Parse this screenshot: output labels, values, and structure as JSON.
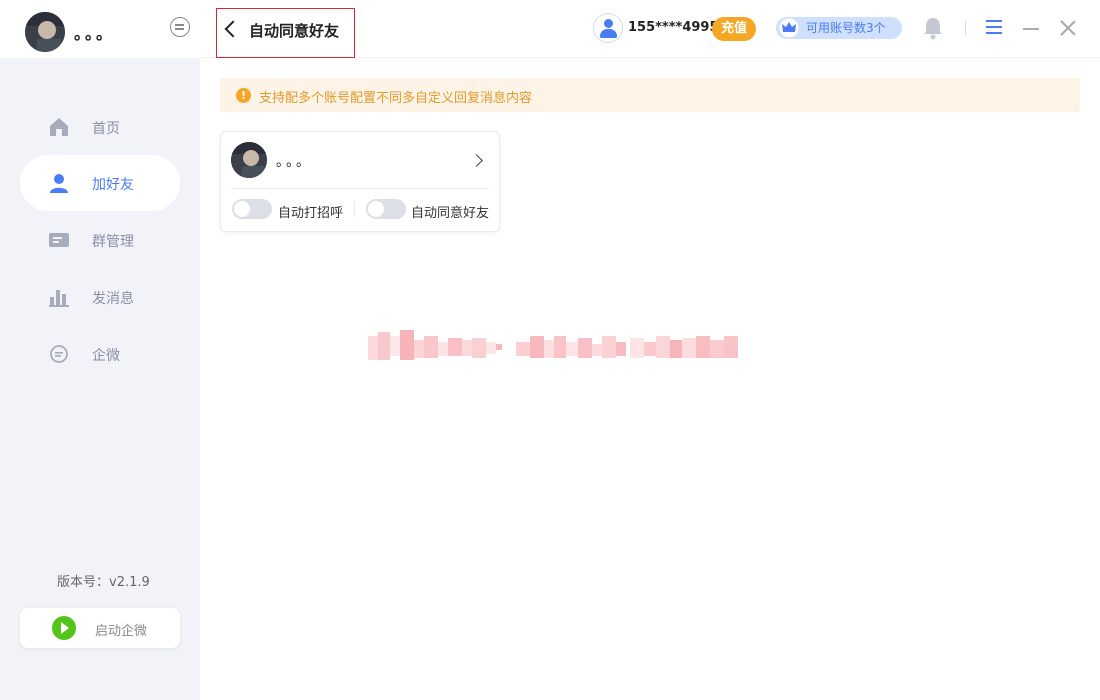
{
  "profile": {
    "name": "。。。"
  },
  "sidebar": {
    "items": [
      {
        "label": "首页",
        "icon": "home-icon",
        "active": false
      },
      {
        "label": "加好友",
        "icon": "user-icon",
        "active": true
      },
      {
        "label": "群管理",
        "icon": "group-manage-icon",
        "active": false
      },
      {
        "label": "发消息",
        "icon": "chart-icon",
        "active": false
      },
      {
        "label": "企微",
        "icon": "chat-bubble-icon",
        "active": false
      }
    ],
    "version": "版本号：v2.1.9",
    "start_label": "启动企微"
  },
  "header": {
    "title": "自动同意好友",
    "phone": "155****4995",
    "recharge": "充值",
    "accounts": "可用账号数3个"
  },
  "notice": {
    "icon": "!",
    "text": "支持配多个账号配置不同多自定义回复消息内容"
  },
  "account_card": {
    "name": "。。。",
    "toggle_greet_label": "自动打招呼",
    "toggle_accept_label": "自动同意好友"
  },
  "colors": {
    "accent": "#4a7cf6",
    "warning": "#f5a623",
    "highlight_border": "#d9282f"
  }
}
